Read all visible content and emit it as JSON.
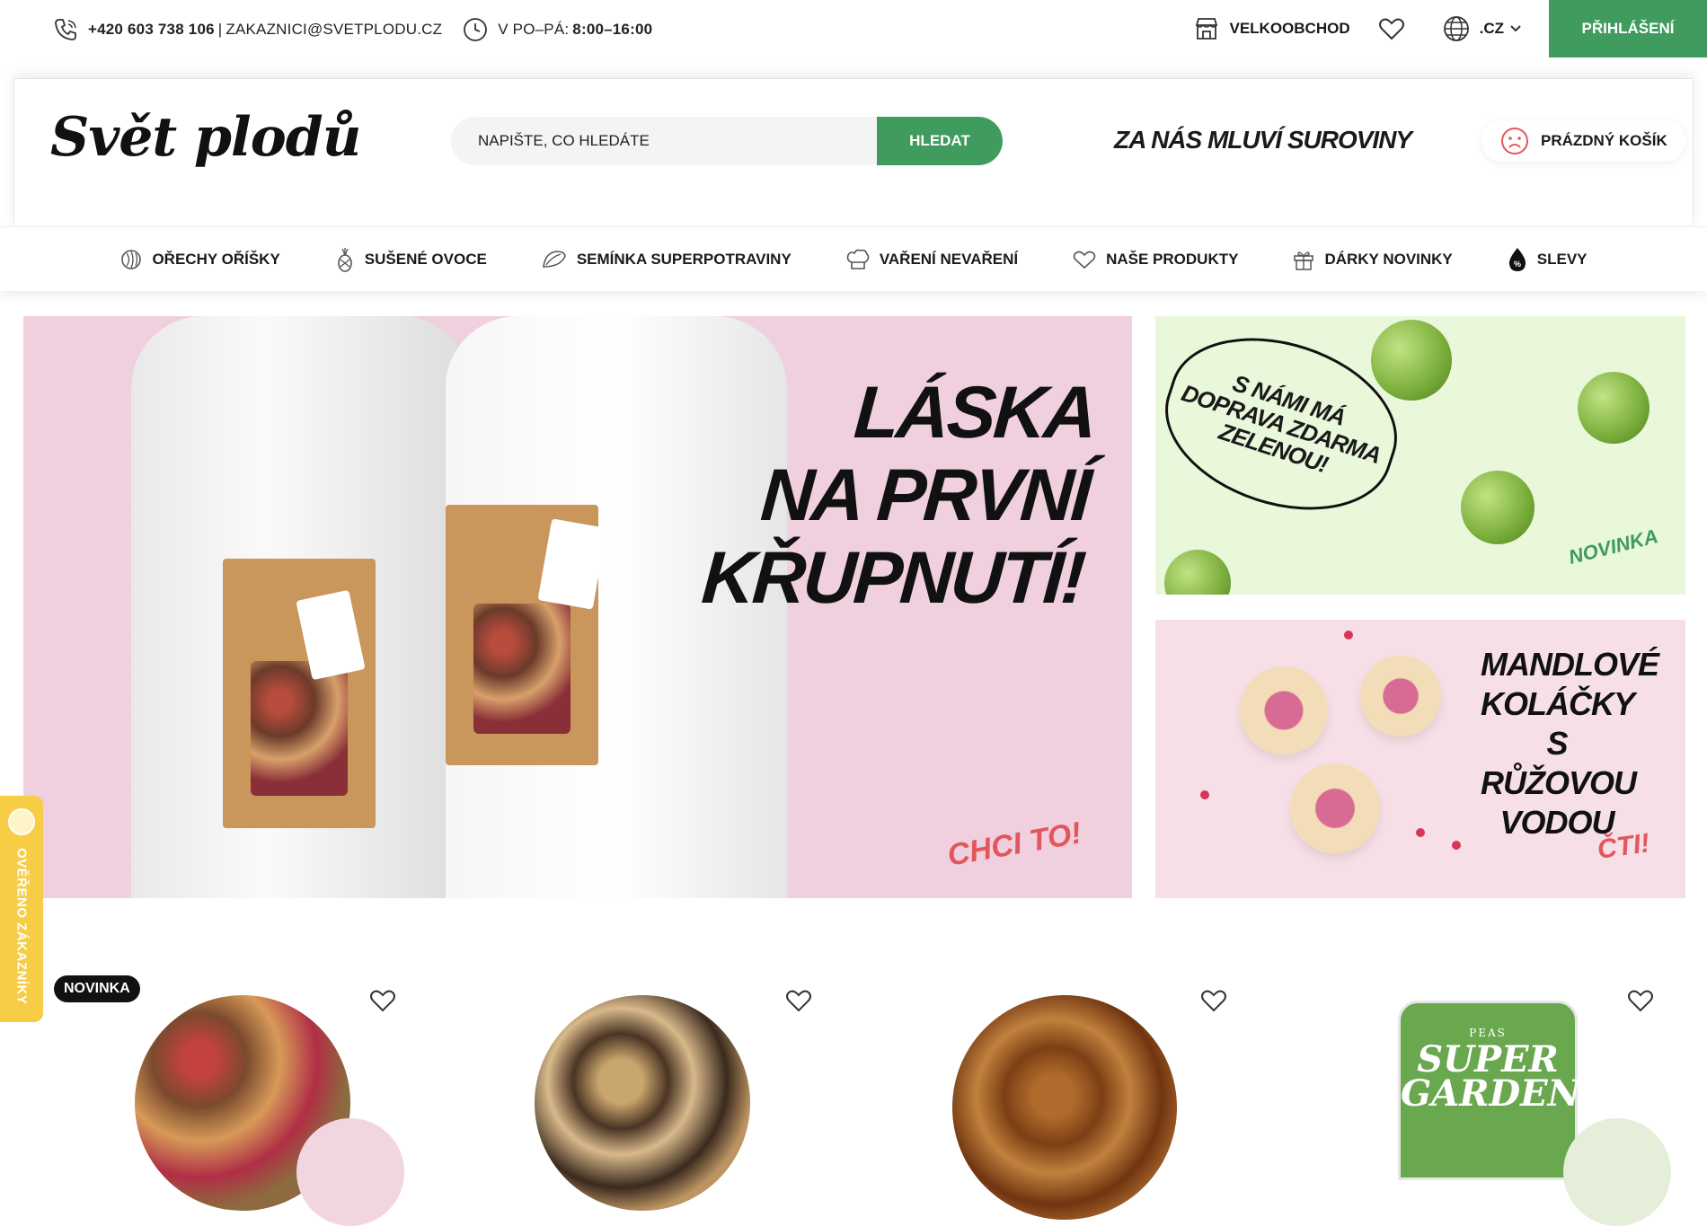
{
  "topbar": {
    "phone": "+420 603 738 106",
    "separator": "|",
    "email": "ZAKAZNICI@SVETPLODU.CZ",
    "hours_label": "V PO–PÁ:",
    "hours_value": "8:00–16:00",
    "wholesale": "VELKOOBCHOD",
    "country": ".CZ",
    "login": "PŘIHLÁŠENÍ"
  },
  "header": {
    "logo": "Svět plodů",
    "search_placeholder": "NAPIŠTE, CO HLEDÁTE",
    "search_button": "HLEDAT",
    "slogan": "ZA NÁS MLUVÍ SUROVINY",
    "cart": "PRÁZDNÝ KOŠÍK"
  },
  "nav": {
    "items": [
      {
        "label": "OŘECHY OŘÍŠKY",
        "icon": "nut-icon"
      },
      {
        "label": "SUŠENÉ OVOCE",
        "icon": "pineapple-icon"
      },
      {
        "label": "SEMÍNKA SUPERPOTRAVINY",
        "icon": "seed-icon"
      },
      {
        "label": "VAŘENÍ NEVAŘENÍ",
        "icon": "chef-hat-icon"
      },
      {
        "label": "NAŠE PRODUKTY",
        "icon": "heart-icon"
      },
      {
        "label": "DÁRKY NOVINKY",
        "icon": "gift-icon"
      },
      {
        "label": "SLEVY",
        "icon": "discount-drop-icon"
      }
    ]
  },
  "hero": {
    "line1": "LÁSKA",
    "line2": "NA PRVNÍ",
    "line3": "KŘUPNUTÍ!",
    "cta": "CHCI TO!"
  },
  "promo1": {
    "bubble": "S NÁMI MÁ DOPRAVA ZDARMA ZELENOU!",
    "tag": "NOVINKA"
  },
  "promo2": {
    "text": "MANDLOVÉ KOLÁČKY S RŮŽOVOU VODOU",
    "cta": "ČTI!"
  },
  "side_badge": "OVĚŘENO ZÁKAZNÍKY",
  "products": {
    "new_badge": "NOVINKA",
    "pack_label": "SUPER GARDEN",
    "pack_sublabel": "PEAS"
  },
  "colors": {
    "accent": "#3f9b5e",
    "hero_pink": "#f0cfde",
    "cta_red": "#e2575c",
    "badge_yellow": "#f6cd44"
  }
}
